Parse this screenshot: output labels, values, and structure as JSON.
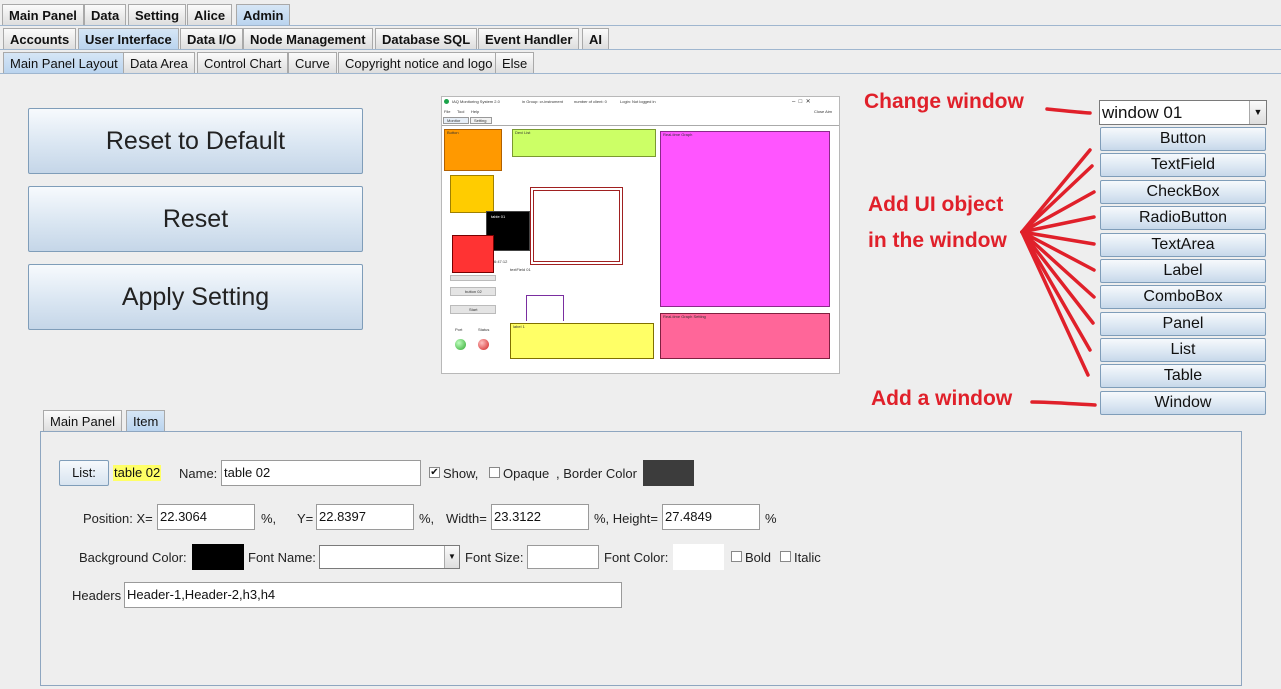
{
  "tabs_level1": [
    "Main Panel",
    "Data",
    "Setting",
    "Alice",
    "Admin"
  ],
  "tabs_level2": [
    "Accounts",
    "User Interface",
    "Data I/O",
    "Node Management",
    "Database SQL",
    "Event Handler",
    "AI"
  ],
  "tabs_level3": [
    "Main Panel Layout",
    "Data Area",
    "Control Chart",
    "Curve",
    "Copyright notice and logo",
    "Else"
  ],
  "buttons": {
    "reset_default": "Reset to Default",
    "reset": "Reset",
    "apply": "Apply Setting"
  },
  "preview": {
    "title": "IAQ Monitoring System 2.0",
    "group_info": "in Group: cr-instrument",
    "client_info": "number of client: 0",
    "login_info": "Login: Not logged in",
    "close_label": "Close Aim",
    "menu": [
      "File",
      "Tool",
      "Help"
    ],
    "tabs": [
      "Monitor",
      "Setting"
    ],
    "labels": {
      "button": "Button",
      "device_list": "Devi List",
      "realtime_graph": "Real-time Graph",
      "realtime_setting": "Real-time Graph Setting",
      "table01": "table 01",
      "time": "6:47:12",
      "textfield": "textField 01",
      "button02": "button 02",
      "start": "Start",
      "port": "Port",
      "status": "Status",
      "label": "label 1"
    }
  },
  "window_select": {
    "value": "window 01"
  },
  "side_buttons": [
    "Button",
    "TextField",
    "CheckBox",
    "RadioButton",
    "TextArea",
    "Label",
    "ComboBox",
    "Panel",
    "List",
    "Table"
  ],
  "window_button": "Window",
  "annotations": {
    "change_window": "Change window",
    "add_ui_1": "Add UI object",
    "add_ui_2": "in the window",
    "add_window": "Add a window"
  },
  "inner_tabs": [
    "Main Panel",
    "Item"
  ],
  "item": {
    "list_button": "List:",
    "selected": "table 02",
    "name_label": "Name:",
    "name_value": "table 02",
    "show_label": "Show,",
    "show_checked": true,
    "opaque_label": "Opaque",
    "border_color_label": ", Border Color",
    "border_color": "#3c3c3c",
    "position_label": "Position: X=",
    "x_value": "22.3064",
    "pct1": "%,",
    "y_label": "Y=",
    "y_value": "22.8397",
    "pct2": "%,",
    "width_label": "Width=",
    "width_value": "23.3122",
    "height_label": "%, Height=",
    "height_value": "27.4849",
    "pct3": "%",
    "bg_color_label": "Background Color:",
    "bg_color": "#000000",
    "font_name_label": "Font Name:",
    "font_name_value": "",
    "font_size_label": "Font Size:",
    "font_size_value": "",
    "font_color_label": "Font Color:",
    "font_color": "#ffffff",
    "bold_label": "Bold",
    "italic_label": "Italic",
    "headers_label": "Headers",
    "headers_value": "Header-1,Header-2,h3,h4"
  }
}
